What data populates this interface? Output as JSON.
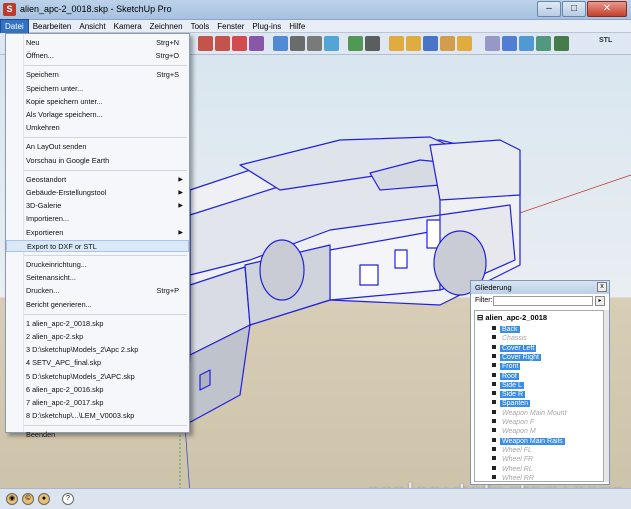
{
  "window": {
    "title": "alien_apc-2_0018.skp - SketchUp Pro",
    "buttons": {
      "minimize": "–",
      "maximize": "□",
      "close": "✕"
    }
  },
  "menubar": [
    "Datei",
    "Bearbeiten",
    "Ansicht",
    "Kamera",
    "Zeichnen",
    "Tools",
    "Fenster",
    "Plug-ins",
    "Hilfe"
  ],
  "toolbar": {
    "icons": [
      "select-icon",
      "eraser-icon",
      "paint-bucket-icon",
      "push-pull-icon",
      "move-icon",
      "rotate-icon",
      "follow-me-icon",
      "orbit-icon",
      "pan-icon",
      "zoom-icon",
      "zoom-extents-icon",
      "walk-icon",
      "look-around-icon",
      "section-icon",
      "component-icon",
      "warehouse-icon",
      "texture-icon",
      "layers-icon",
      "scale-icon",
      "view-front-icon",
      "view-top-icon",
      "view-iso-icon",
      "stl-export-icon"
    ],
    "stl_label": "STL"
  },
  "file_menu": {
    "groups": [
      [
        {
          "label": "Neu",
          "shortcut": "Strg+N"
        },
        {
          "label": "Öffnen...",
          "shortcut": "Strg+O"
        }
      ],
      [
        {
          "label": "Speichern",
          "shortcut": "Strg+S"
        },
        {
          "label": "Speichern unter...",
          "shortcut": ""
        },
        {
          "label": "Kopie speichern unter...",
          "shortcut": ""
        },
        {
          "label": "Als Vorlage speichern...",
          "shortcut": ""
        },
        {
          "label": "Umkehren",
          "shortcut": ""
        }
      ],
      [
        {
          "label": "An LayOut senden",
          "shortcut": ""
        },
        {
          "label": "Vorschau in Google Earth",
          "shortcut": ""
        }
      ],
      [
        {
          "label": "Geostandort",
          "shortcut": "",
          "submenu": true
        },
        {
          "label": "Gebäude-Erstellungstool",
          "shortcut": "",
          "submenu": true
        },
        {
          "label": "3D-Galerie",
          "shortcut": "",
          "submenu": true
        },
        {
          "label": "Importieren...",
          "shortcut": ""
        },
        {
          "label": "Exportieren",
          "shortcut": "",
          "submenu": true
        },
        {
          "label": "Export to DXF or STL",
          "shortcut": "",
          "hover": true
        }
      ],
      [
        {
          "label": "Druckeinrichtung...",
          "shortcut": ""
        },
        {
          "label": "Seitenansicht...",
          "shortcut": ""
        },
        {
          "label": "Drucken...",
          "shortcut": "Strg+P"
        },
        {
          "label": "Bericht generieren...",
          "shortcut": ""
        }
      ],
      [
        {
          "label": "1 alien_apc-2_0018.skp",
          "shortcut": ""
        },
        {
          "label": "2 alien_apc-2.skp",
          "shortcut": ""
        },
        {
          "label": "3 D:\\sketchup\\Models_2\\Apc 2.skp",
          "shortcut": ""
        },
        {
          "label": "4 SETV_APC_final.skp",
          "shortcut": ""
        },
        {
          "label": "5 D:\\sketchup\\Models_2\\APC.skp",
          "shortcut": ""
        },
        {
          "label": "6 alien_apc-2_0016.skp",
          "shortcut": ""
        },
        {
          "label": "7 alien_apc-2_0017.skp",
          "shortcut": ""
        },
        {
          "label": "8 D:\\sketchup\\...\\LEM_V0003.skp",
          "shortcut": ""
        }
      ],
      [
        {
          "label": "Beenden",
          "shortcut": ""
        }
      ]
    ]
  },
  "outliner": {
    "title": "Gliederung",
    "close": "x",
    "filter_label": "Filter:",
    "filter_value": "",
    "root": "alien_apc-2_0018",
    "items": [
      {
        "label": "Back",
        "state": "sel"
      },
      {
        "label": "Chassis",
        "state": "hid"
      },
      {
        "label": "Cover Left",
        "state": "sel"
      },
      {
        "label": "Cover Right",
        "state": "sel"
      },
      {
        "label": "Front",
        "state": "sel"
      },
      {
        "label": "Roof",
        "state": "sel"
      },
      {
        "label": "Side L",
        "state": "sel"
      },
      {
        "label": "Side R",
        "state": "sel"
      },
      {
        "label": "Spanten",
        "state": "sel"
      },
      {
        "label": "Weapon Main Mount",
        "state": "hid"
      },
      {
        "label": "Weapon F",
        "state": "hid"
      },
      {
        "label": "Weapon M",
        "state": "hid"
      },
      {
        "label": "Weapon Main Rails",
        "state": "sel"
      },
      {
        "label": "Wheel FL",
        "state": "hid"
      },
      {
        "label": "Wheel FR",
        "state": "hid"
      },
      {
        "label": "Wheel RL",
        "state": "hid"
      },
      {
        "label": "Wheel RR",
        "state": "hid"
      }
    ]
  },
  "watermark": "scaleautofactory.com",
  "colors": {
    "selection_blue": "#2020e0",
    "accent": "#3a8ee6"
  }
}
